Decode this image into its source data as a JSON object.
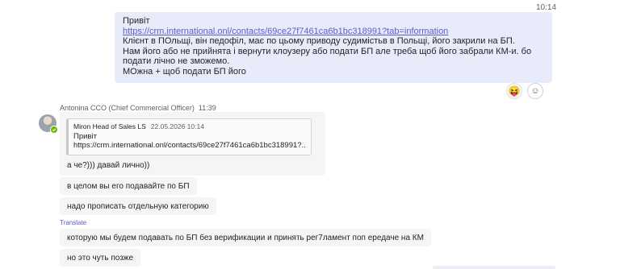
{
  "outgoing": {
    "time": "10:14",
    "greeting": "Привіт",
    "link": "https://crm.international.onl/contacts/69ce27f7461ca6b1bc318991?tab=information",
    "body": "Клієнт в ПОльщі, він педофіл, має по цьому приводу судимістьв в Польщі, його закрили на БП.\nНам його або не прийнята і вернути клоузеру або подати БП але треба щоб його забрали КМ-и. бо подати лічно не зможемо.\nМОжна + щоб подати БП його",
    "reactions": [
      {
        "icon": "laughing-emoji-icon",
        "glyph": "😝"
      },
      {
        "icon": "add-reaction-icon",
        "glyph": "☺"
      }
    ]
  },
  "incoming": {
    "sender_name": "Antonina CCO (Chief Commercial Officer)",
    "time": "11:39",
    "presence_color": "#6bb700",
    "quote": {
      "author": "Miron Head of Sales LS",
      "timestamp": "22.05.2026 10:14",
      "line1": "Привіт",
      "line2": "https://crm.international.onl/contacts/69ce27f7461ca6b1bc318991?..."
    },
    "reply": "а че?))) давай лично))",
    "messages": [
      "в целом вы его подавайте по БП",
      "надо прописать отдельную категорию",
      "которую мы будем подавать по БП без верификации и принять рег7ламент поп ередаче на КМ",
      "но это чуть позже"
    ],
    "translate_label": "Translate"
  },
  "colors": {
    "accent": "#5b5fc7",
    "outgoing_bubble": "#e8ebfa",
    "incoming_bubble": "#f5f5f5"
  }
}
